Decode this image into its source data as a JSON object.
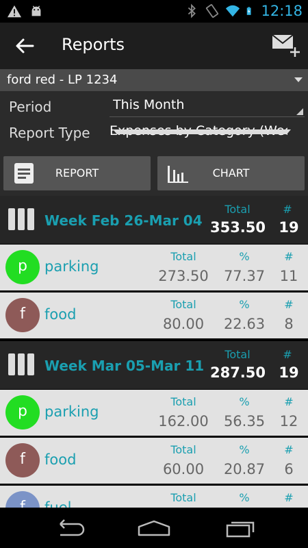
{
  "status_bar": {
    "time": "12:18",
    "icons": [
      "warning-icon",
      "android-icon",
      "bluetooth-icon",
      "vibrate-icon",
      "wifi-icon",
      "battery-charging-icon"
    ]
  },
  "action_bar": {
    "title": "Reports",
    "back_icon": "arrow-back-icon",
    "action_icon": "mail-add-icon"
  },
  "filters": {
    "vehicle": "ford red - LP 1234",
    "period_label": "Period",
    "period_value": "This Month",
    "report_type_label": "Report Type",
    "report_type_value": "Expenses by Category (Wee.."
  },
  "buttons": {
    "report_label": "REPORT",
    "chart_label": "CHART"
  },
  "colors": {
    "accent": "#1a9fb0",
    "parking": "#22dd22",
    "food": "#8e5a58",
    "third": "#7b93c7"
  },
  "weeks": [
    {
      "title": "Week Feb 26-Mar 04",
      "total_header": "Total",
      "count_header": "#",
      "total": "353.50",
      "count": "19",
      "categories": [
        {
          "letter": "p",
          "name": "parking",
          "total_header": "Total",
          "pct_header": "%",
          "count_header": "#",
          "total": "273.50",
          "pct": "77.37",
          "count": "11"
        },
        {
          "letter": "f",
          "name": "food",
          "total_header": "Total",
          "pct_header": "%",
          "count_header": "#",
          "total": "80.00",
          "pct": "22.63",
          "count": "8"
        }
      ]
    },
    {
      "title": "Week Mar 05-Mar 11",
      "total_header": "Total",
      "count_header": "#",
      "total": "287.50",
      "count": "19",
      "categories": [
        {
          "letter": "p",
          "name": "parking",
          "total_header": "Total",
          "pct_header": "%",
          "count_header": "#",
          "total": "162.00",
          "pct": "56.35",
          "count": "12"
        },
        {
          "letter": "f",
          "name": "food",
          "total_header": "Total",
          "pct_header": "%",
          "count_header": "#",
          "total": "60.00",
          "pct": "20.87",
          "count": "6"
        },
        {
          "letter": "f",
          "name": "fuel",
          "total_header": "Total",
          "pct_header": "%",
          "count_header": "#",
          "total": "",
          "pct": "",
          "count": ""
        }
      ]
    }
  ],
  "nav_bar": [
    "back-nav-icon",
    "home-nav-icon",
    "recents-nav-icon"
  ]
}
